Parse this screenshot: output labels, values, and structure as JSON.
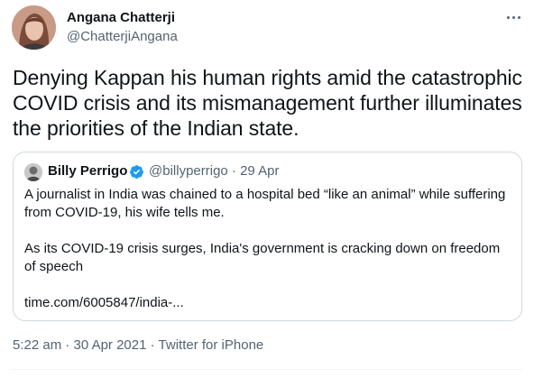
{
  "tweet": {
    "author": {
      "name": "Angana Chatterji",
      "handle": "@ChatterjiAngana",
      "avatar": "avatar-photo"
    },
    "more_icon": "more-horizontal-icon",
    "text": "Denying Kappan his human rights amid the catastrophic COVID crisis and its mismanagement further illuminates the priorities of the Indian state.",
    "quote": {
      "author_name": "Billy Perrigo",
      "verified_icon": "verified-badge-icon",
      "verified_color": "#1d9bf0",
      "meta": "@billyperrigo · 29 Apr",
      "paragraphs": [
        "A journalist in India was chained to a hospital bed “like an animal” while suffering from COVID-19, his wife tells me.",
        "As its COVID-19 crisis surges, India's government is cracking down on freedom of speech",
        "time.com/6005847/india-..."
      ]
    },
    "timestamp": {
      "time": "5:22 am",
      "separator": "·",
      "date": "30 Apr 2021",
      "source": "Twitter for iPhone"
    }
  }
}
